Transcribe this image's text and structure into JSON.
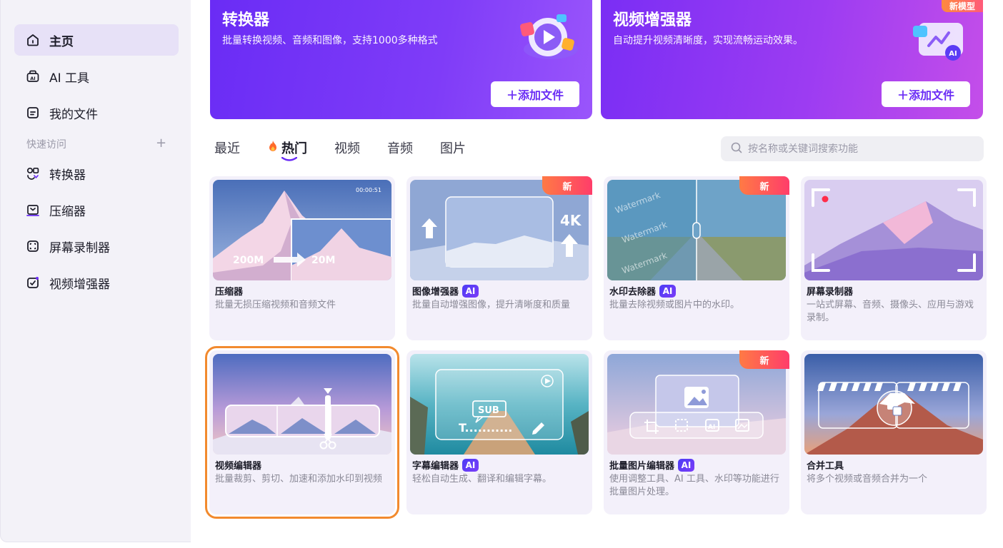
{
  "sidebar": {
    "items": [
      {
        "label": "主页",
        "icon": "home-icon",
        "active": true
      },
      {
        "label": "AI 工具",
        "icon": "ai-tools-icon"
      },
      {
        "label": "我的文件",
        "icon": "files-icon"
      }
    ],
    "quick_access_label": "快速访问",
    "quick_add_glyph": "+",
    "quick_items": [
      {
        "label": "转换器",
        "icon": "converter-icon"
      },
      {
        "label": "压缩器",
        "icon": "compressor-icon"
      },
      {
        "label": "屏幕录制器",
        "icon": "screen-recorder-icon"
      },
      {
        "label": "视频增强器",
        "icon": "video-enhancer-icon"
      }
    ]
  },
  "banners": [
    {
      "title": "转换器",
      "desc": "批量转换视频、音频和图像，支持1000多种格式",
      "button": "＋添加文件"
    },
    {
      "title": "视频增强器",
      "desc": "自动提升视频清晰度，实现流畅运动效果。",
      "button": "＋添加文件",
      "badge": "新模型"
    }
  ],
  "tabs": [
    {
      "label": "最近"
    },
    {
      "label": "热门",
      "active": true
    },
    {
      "label": "视频"
    },
    {
      "label": "音频"
    },
    {
      "label": "图片"
    }
  ],
  "search": {
    "placeholder": "按名称或关键词搜索功能"
  },
  "cards": [
    {
      "name": "压缩器",
      "desc": "批量无损压缩视频和音频文件",
      "ai": false,
      "new": false,
      "thumb": {
        "time": "00:00:51",
        "from": "200M",
        "to": "20M"
      }
    },
    {
      "name": "图像增强器",
      "desc": "批量自动增强图像，提升清晰度和质量",
      "ai": true,
      "new": true,
      "thumb": {
        "res": "4K"
      }
    },
    {
      "name": "水印去除器",
      "desc": "批量去除视频或图片中的水印。",
      "ai": true,
      "new": true,
      "thumb": {
        "mark": "Watermark"
      }
    },
    {
      "name": "屏幕录制器",
      "desc": "一站式屏幕、音频、摄像头、应用与游戏录制。",
      "ai": false,
      "new": false
    },
    {
      "name": "视频编辑器",
      "desc": "批量裁剪、剪切、加速和添加水印到视频",
      "ai": false,
      "new": false,
      "selected": true
    },
    {
      "name": "字幕编辑器",
      "desc": "轻松自动生成、翻译和编辑字幕。",
      "ai": true,
      "new": false,
      "thumb": {
        "sub": "SUB",
        "text": "T..........."
      }
    },
    {
      "name": "批量图片编辑器",
      "desc": "使用调整工具、AI 工具、水印等功能进行批量图片处理。",
      "ai": true,
      "new": true
    },
    {
      "name": "合并工具",
      "desc": "将多个视频或音频合并为一个",
      "ai": false,
      "new": false
    }
  ],
  "labels": {
    "ai": "AI",
    "new": "新"
  },
  "colors": {
    "accent": "#6a2cf5",
    "highlight": "#f28a2e",
    "new_tag": "#ff4d5e"
  }
}
